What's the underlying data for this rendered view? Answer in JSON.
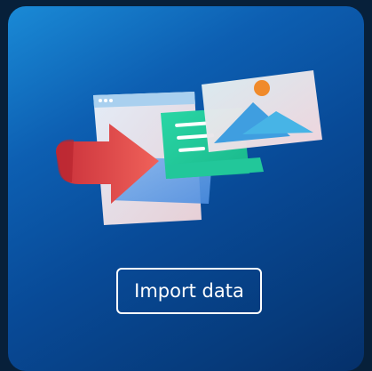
{
  "card": {
    "illustration_icon": "import-data-illustration",
    "button_label": "Import data"
  },
  "colors": {
    "card_gradient_start": "#1a8ad6",
    "card_gradient_end": "#05306a",
    "arrow": "#e8524b",
    "button_border": "#ffffff"
  }
}
